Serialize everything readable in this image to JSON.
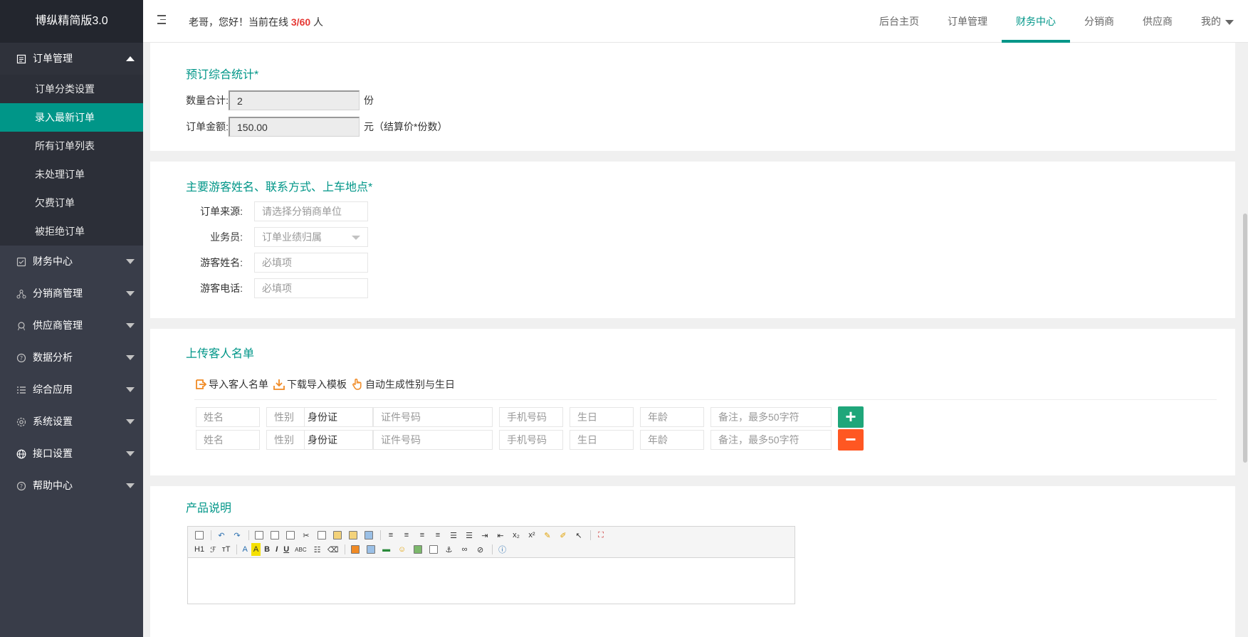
{
  "brand": "博纵精简版3.0",
  "header": {
    "greeting_prefix": "老哥，您好！当前在线",
    "online": "3/60",
    "greeting_suffix": "人",
    "nav": [
      {
        "label": "后台主页",
        "active": false
      },
      {
        "label": "订单管理",
        "active": false
      },
      {
        "label": "财务中心",
        "active": true
      },
      {
        "label": "分销商",
        "active": false
      },
      {
        "label": "供应商",
        "active": false
      },
      {
        "label": "我的",
        "active": false
      }
    ]
  },
  "sidebar": {
    "groups": [
      {
        "label": "订单管理",
        "icon": "order-icon",
        "open": true,
        "items": [
          "订单分类设置",
          "录入最新订单",
          "所有订单列表",
          "未处理订单",
          "欠费订单",
          "被拒绝订单"
        ],
        "active_item": "录入最新订单"
      },
      {
        "label": "财务中心",
        "icon": "finance-icon"
      },
      {
        "label": "分销商管理",
        "icon": "distributor-icon"
      },
      {
        "label": "供应商管理",
        "icon": "supplier-icon"
      },
      {
        "label": "数据分析",
        "icon": "analysis-icon"
      },
      {
        "label": "综合应用",
        "icon": "apps-icon"
      },
      {
        "label": "系统设置",
        "icon": "settings-icon"
      },
      {
        "label": "接口设置",
        "icon": "globe-icon"
      },
      {
        "label": "帮助中心",
        "icon": "help-icon"
      }
    ]
  },
  "stats": {
    "title": "预订综合统计*",
    "qty_label": "数量合计:",
    "qty_value": "2",
    "qty_unit": "份",
    "amount_label": "订单金额:",
    "amount_value": "150.00",
    "amount_unit": "元（结算价*份数）"
  },
  "guest": {
    "title": "主要游客姓名、联系方式、上车地点*",
    "source_label": "订单来源:",
    "source_placeholder": "请选择分销商单位",
    "sales_label": "业务员:",
    "sales_placeholder": "订单业绩归属",
    "name_label": "游客姓名:",
    "name_placeholder": "必填项",
    "phone_label": "游客电话:",
    "phone_placeholder": "必填项"
  },
  "upload": {
    "title": "上传客人名单",
    "import_label": "导入客人名单",
    "template_label": "下载导入模板",
    "auto_label": "自动生成性别与生日",
    "rows": [
      {
        "name": "姓名",
        "gender": "性别",
        "idtype": "身份证",
        "idno": "证件号码",
        "mobile": "手机号码",
        "birthday": "生日",
        "age": "年龄",
        "note": "备注，最多50字符",
        "action": "+"
      },
      {
        "name": "姓名",
        "gender": "性别",
        "idtype": "身份证",
        "idno": "证件号码",
        "mobile": "手机号码",
        "birthday": "生日",
        "age": "年龄",
        "note": "备注，最多50字符",
        "action": "−"
      }
    ]
  },
  "product": {
    "title": "产品说明",
    "toolbar_row2_text": [
      "H1",
      "ℱ",
      "тT",
      "A",
      "A",
      "B",
      "I",
      "U",
      "ABC"
    ]
  },
  "colors": {
    "accent": "#009688",
    "add": "#1fa67a",
    "del": "#ff5722",
    "online": "#e53935"
  }
}
